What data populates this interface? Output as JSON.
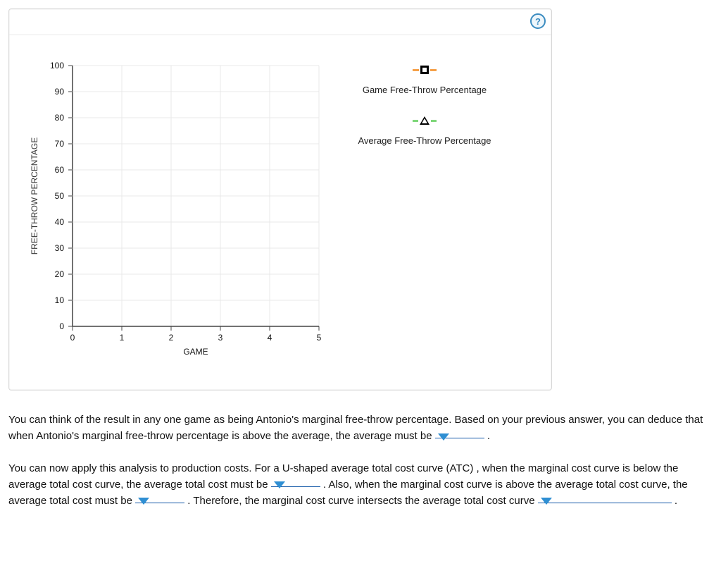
{
  "help_label": "?",
  "chart_data": {
    "type": "line",
    "x": [
      0,
      1,
      2,
      3,
      4,
      5
    ],
    "xlabel": "GAME",
    "ylabel": "FREE-THROW PERCENTAGE",
    "xlim": [
      0,
      5
    ],
    "ylim": [
      0,
      100
    ],
    "yticks": [
      0,
      10,
      20,
      30,
      40,
      50,
      60,
      70,
      80,
      90,
      100
    ],
    "xticks": [
      0,
      1,
      2,
      3,
      4,
      5
    ],
    "series": [
      {
        "name": "Game Free-Throw Percentage",
        "marker": "square",
        "color": "#f5a14a",
        "values": []
      },
      {
        "name": "Average Free-Throw Percentage",
        "marker": "triangle",
        "color": "#7fd77a",
        "values": []
      }
    ]
  },
  "paragraph1": {
    "t1": "You can think of the result in any one game as being Antonio's marginal free-throw percentage. Based on your previous answer, you can deduce that when Antonio's marginal free-throw percentage is above the average, the average must be ",
    "t2": " ."
  },
  "paragraph2": {
    "t1": "You can now apply this analysis to production costs. For a U-shaped average total cost curve (ATC) , when the marginal cost curve is below the average total cost curve, the average total cost must be ",
    "t2": " . Also, when the marginal cost curve is above the average total cost curve, the average total cost must be ",
    "t3": " . Therefore, the marginal cost curve intersects the average total cost curve ",
    "t4": " ."
  }
}
